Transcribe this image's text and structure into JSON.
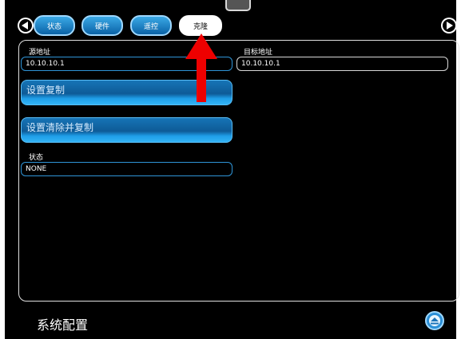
{
  "tabs": [
    {
      "label": "状态"
    },
    {
      "label": "硬件"
    },
    {
      "label": "遥控"
    },
    {
      "label": "克隆"
    }
  ],
  "form": {
    "source_label": "源地址",
    "source_value": "10.10.10.1",
    "target_label": "目标地址",
    "target_value": "10.10.10.1",
    "set_copy_label": "设置复制",
    "set_clear_copy_label": "设置清除并复制",
    "status_label": "状态",
    "status_value": "NONE"
  },
  "footer": {
    "title": "系统配置"
  },
  "colors": {
    "accent": "#2f95d8",
    "arrow": "#ee0000"
  }
}
